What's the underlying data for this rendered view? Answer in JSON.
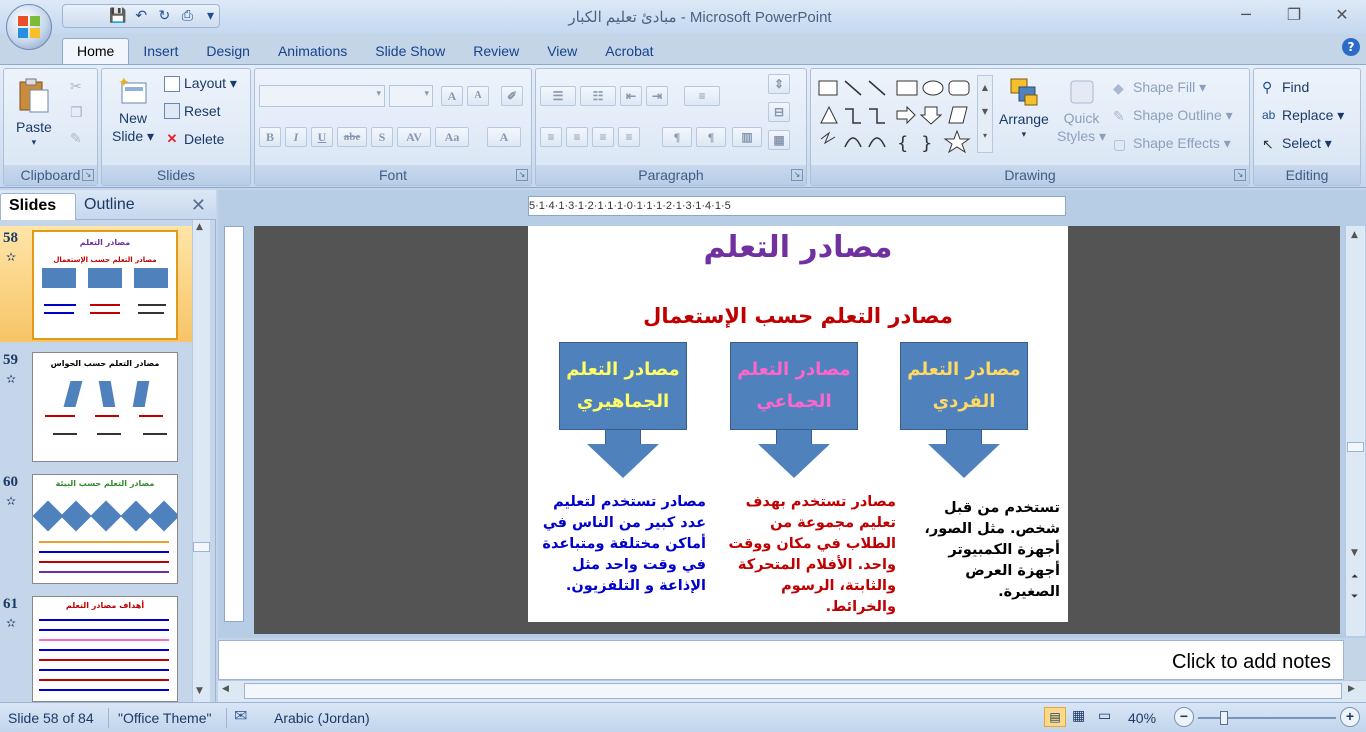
{
  "window": {
    "title": "مبادئ تعليم الكبار - Microsoft PowerPoint",
    "minimize": "─",
    "restore": "❐",
    "close": "✕"
  },
  "qat": {
    "save": "💾",
    "undo": "↶",
    "redo": "↻",
    "more": "▾"
  },
  "ribbon_tabs": [
    "Home",
    "Insert",
    "Design",
    "Animations",
    "Slide Show",
    "Review",
    "View",
    "Acrobat"
  ],
  "help": "?",
  "ribbon": {
    "clipboard": {
      "label": "Clipboard",
      "paste": "Paste"
    },
    "slides": {
      "label": "Slides",
      "new_slide_line1": "New",
      "new_slide_line2": "Slide ▾",
      "layout": "Layout ▾",
      "reset": "Reset",
      "delete": "Delete"
    },
    "font": {
      "label": "Font",
      "bold": "B",
      "italic": "I",
      "underline": "U",
      "strike": "abe",
      "shadow": "S",
      "spacing": "AV",
      "case": "Aa",
      "color": "A",
      "grow": "A",
      "shrink": "A"
    },
    "paragraph": {
      "label": "Paragraph"
    },
    "drawing": {
      "label": "Drawing",
      "arrange": "Arrange",
      "quick_styles_line1": "Quick",
      "quick_styles_line2": "Styles ▾",
      "shape_fill": "Shape Fill ▾",
      "shape_outline": "Shape Outline ▾",
      "shape_effects": "Shape Effects ▾"
    },
    "editing": {
      "label": "Editing",
      "find": "Find",
      "replace": "Replace ▾",
      "select": "Select ▾"
    }
  },
  "panel": {
    "tab_slides": "Slides",
    "tab_outline": "Outline",
    "close": "✕",
    "thumbnails": [
      {
        "number": "58",
        "title": "مصادر التعلم",
        "subtitle": "مصادر التعلم حسب الإستعمال",
        "selected": true
      },
      {
        "number": "59",
        "title": "مصادر التعلم حسب الحواس",
        "selected": false
      },
      {
        "number": "60",
        "title": "مصادر التعلم حسب البيئة",
        "selected": false
      },
      {
        "number": "61",
        "title": "أهداف مصادر التعلم",
        "selected": false
      }
    ]
  },
  "ruler": "5·1·4·1·3·1·2·1·1·1·0·1·1·1·2·1·3·1·4·1·5",
  "slide": {
    "title": "مصادر التعلم",
    "subtitle": "مصادر التعلم حسب الإستعمال",
    "callouts": [
      {
        "label": "مصادر التعلم الفردي",
        "color": "#ffd966"
      },
      {
        "label": "مصادر التعلم الجماعي",
        "color": "#ff66cc"
      },
      {
        "label": "مصادر التعلم الجماهيري",
        "color": "#ffff66"
      }
    ],
    "descriptions": [
      {
        "text": "تستخدم من قبل شخص. مثل الصور، أجهزة الكمبيوتر أجهزة العرض الصغيرة.",
        "color": "#000000"
      },
      {
        "text": "مصادر تستخدم بهدف تعليم مجموعة من الطلاب في مكان ووقت واحد. الأفلام المتحركة والثابتة، الرسوم والخرائط.",
        "color": "#c00000"
      },
      {
        "text": "مصادر تستخدم لتعليم عدد كبير من الناس في أماكن مختلفة ومتباعدة في وقت واحد مثل الإذاعة و التلفزيون.",
        "color": "#0000cc"
      }
    ]
  },
  "notes": {
    "placeholder": "Click to add notes"
  },
  "status": {
    "slide_count": "Slide 58 of 84",
    "theme": "\"Office Theme\"",
    "language": "Arabic (Jordan)",
    "zoom": "40%"
  }
}
